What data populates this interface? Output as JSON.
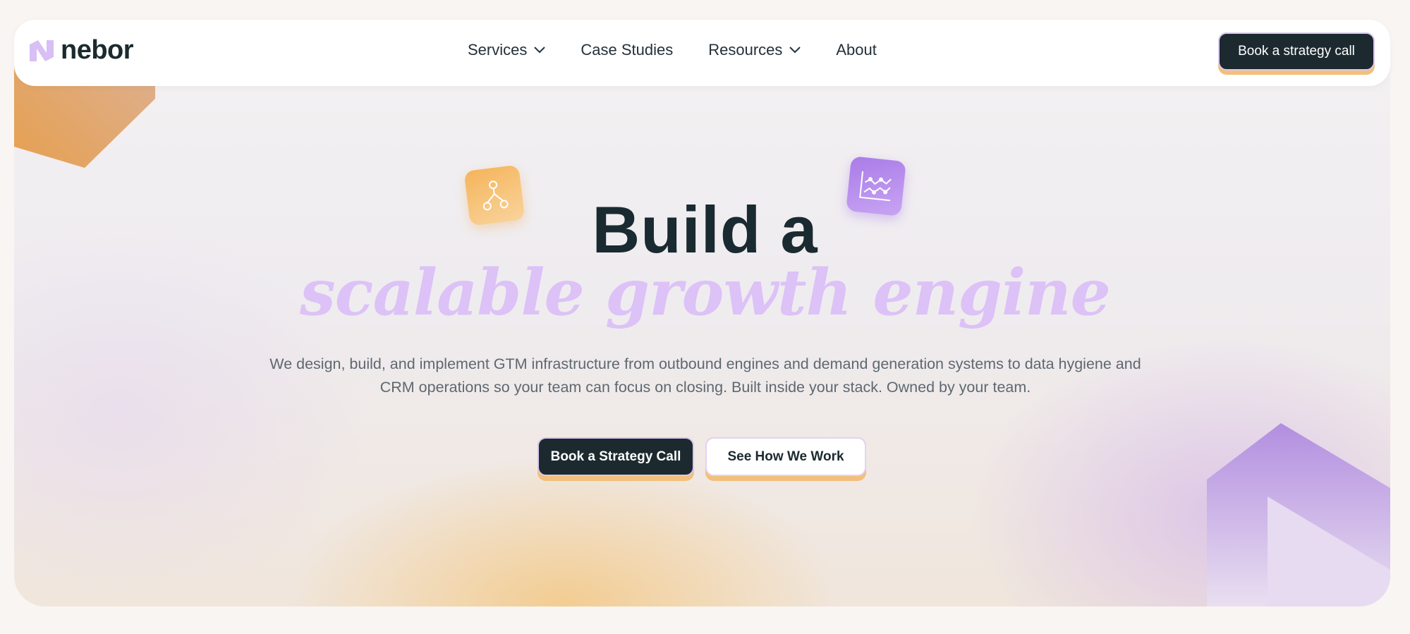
{
  "brand": {
    "name": "nebor"
  },
  "nav": {
    "items": [
      {
        "label": "Services",
        "has_dropdown": true
      },
      {
        "label": "Case Studies",
        "has_dropdown": false
      },
      {
        "label": "Resources",
        "has_dropdown": true
      },
      {
        "label": "About",
        "has_dropdown": false
      }
    ],
    "cta_label": "Book a strategy call"
  },
  "hero": {
    "title_line1": "Build a",
    "title_line2": "scalable growth engine",
    "description": "We design, build, and implement GTM infrastructure from outbound engines and demand generation systems to data hygiene and CRM operations so your team can focus on closing. Built inside your stack. Owned by your team.",
    "primary_cta": "Book a Strategy Call",
    "secondary_cta": "See How We Work"
  },
  "icons": {
    "logo": "nebor-logo-icon",
    "tile_left": "hierarchy-icon",
    "tile_right": "line-chart-icon",
    "dropdown": "chevron-down-icon"
  },
  "colors": {
    "dark": "#1c2a30",
    "accent_purple": "#dcc2f7",
    "accent_orange": "#f2c07a",
    "background": "#f9f5f2"
  }
}
